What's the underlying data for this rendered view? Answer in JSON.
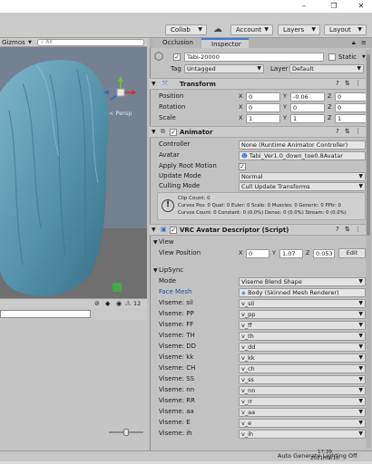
{
  "window": {
    "minimize": "–",
    "restore": "❐",
    "close": "✕"
  },
  "toolbar": {
    "collab": "Collab",
    "account": "Account",
    "layers": "Layers",
    "layout": "Layout",
    "cloud_icon": "cloud-icon"
  },
  "scene": {
    "gizmos": "Gizmos",
    "search_placeholder": "All",
    "persp": "< Persp"
  },
  "console": {
    "count": "12"
  },
  "inspector": {
    "tabs": [
      {
        "label": "Occlusion"
      },
      {
        "label": "Inspector"
      }
    ],
    "object_name": "Tabi-20000",
    "static_label": "Static",
    "tag_label": "Tag",
    "tag_value": "Untagged",
    "layer_label": "Layer",
    "layer_value": "Default",
    "transform": {
      "title": "Transform",
      "position_label": "Position",
      "rotation_label": "Rotation",
      "scale_label": "Scale",
      "position": {
        "x": "0",
        "y": "-0.06",
        "z": "0"
      },
      "rotation": {
        "x": "0",
        "y": "0",
        "z": "0"
      },
      "scale": {
        "x": "1",
        "y": "1",
        "z": "1"
      }
    },
    "animator": {
      "title": "Animator",
      "controller_label": "Controller",
      "controller_value": "None (Runtime Animator Controller)",
      "avatar_label": "Avatar",
      "avatar_value": "Tabi_Ver1.0_down_toe0.8Avatar",
      "apply_root_motion_label": "Apply Root Motion",
      "update_mode_label": "Update Mode",
      "update_mode_value": "Normal",
      "culling_mode_label": "Culling Mode",
      "culling_mode_value": "Cull Update Transforms",
      "info_line1": "Clip Count: 0",
      "info_line2": "Curves Pos: 0 Quat: 0 Euler: 0 Scale: 0 Muscles: 0 Generic: 0 PPtr: 0",
      "info_line3": "Curves Count: 0 Constant: 0 (0.0%) Dense: 0 (0.0%) Stream: 0 (0.0%)"
    },
    "vrc": {
      "title": "VRC Avatar Descriptor (Script)",
      "view_section": "View",
      "view_position_label": "View Position",
      "view_position": {
        "x": "0",
        "y": "1.07",
        "z": "0.053"
      },
      "edit_button": "Edit",
      "lipsync_section": "LipSync",
      "mode_label": "Mode",
      "mode_value": "Viseme Blend Shape",
      "face_mesh_label": "Face Mesh",
      "face_mesh_value": "Body (Skinned Mesh Renderer)",
      "visemes": [
        {
          "label": "Viseme: sil",
          "value": "v_sil"
        },
        {
          "label": "Viseme: PP",
          "value": "v_pp"
        },
        {
          "label": "Viseme: FF",
          "value": "v_ff"
        },
        {
          "label": "Viseme: TH",
          "value": "v_th"
        },
        {
          "label": "Viseme: DD",
          "value": "v_dd"
        },
        {
          "label": "Viseme: kk",
          "value": "v_kk"
        },
        {
          "label": "Viseme: CH",
          "value": "v_ch"
        },
        {
          "label": "Viseme: SS",
          "value": "v_ss"
        },
        {
          "label": "Viseme: nn",
          "value": "v_nn"
        },
        {
          "label": "Viseme: RR",
          "value": "v_rr"
        },
        {
          "label": "Viseme: aa",
          "value": "v_aa"
        },
        {
          "label": "Viseme: E",
          "value": "v_e"
        },
        {
          "label": "Viseme: ih",
          "value": "v_ih"
        }
      ]
    }
  },
  "status": {
    "auto_lighting": "Auto Generate Lighting Off",
    "time": "17:39",
    "date": "2021/09/10"
  },
  "colors": {
    "hair": "#4f8fa8",
    "sky": "#717e8d",
    "ground": "#707070",
    "panel": "#c2c2c2"
  }
}
